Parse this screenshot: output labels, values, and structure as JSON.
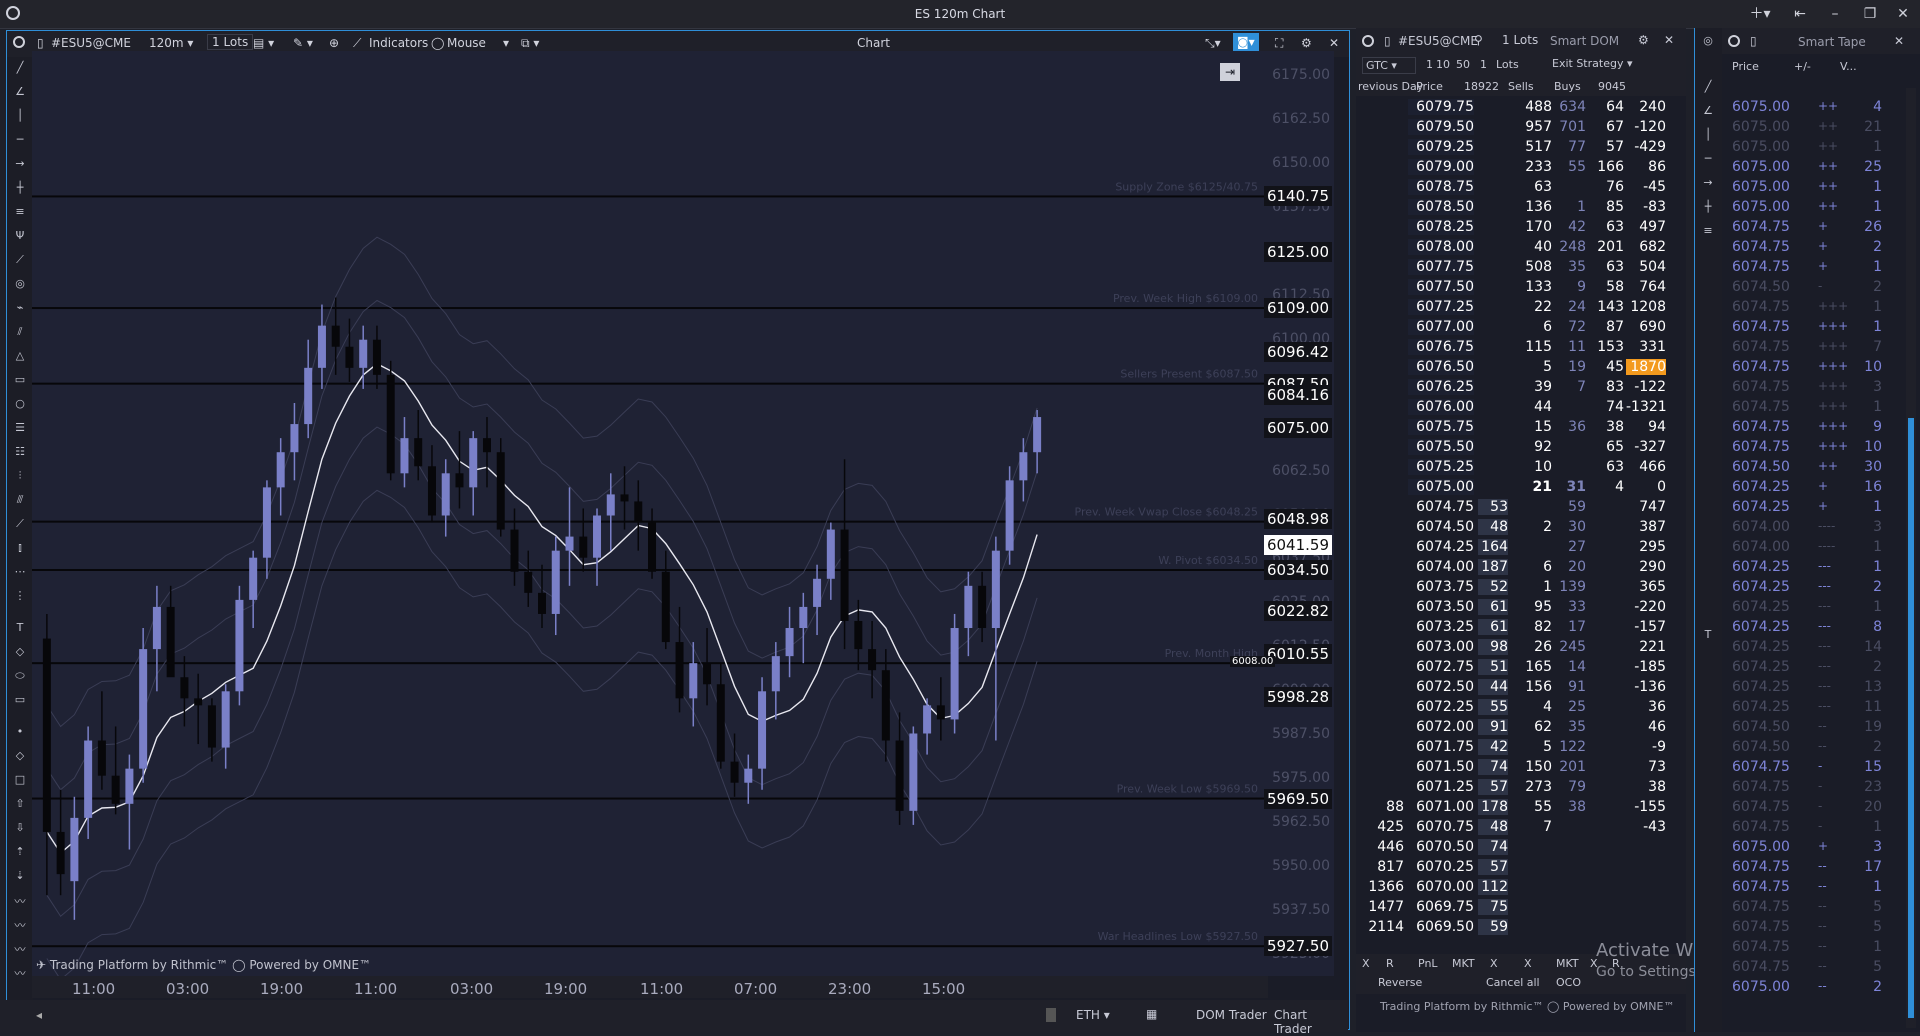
{
  "window": {
    "title": "ES 120m Chart"
  },
  "chart_panel": {
    "symbol": "#ESU5@CME",
    "timeframe": "120m",
    "lots": "1 Lots",
    "indicators_label": "Indicators",
    "mouse_label": "Mouse",
    "title": "Chart",
    "footer_left": "Trading Platform by Rithmic™",
    "footer_right": "Powered by OMNE™",
    "session": "ETH",
    "dom_trader_label": "DOM Trader",
    "chart_trader_label": "Chart Trader"
  },
  "chart_data": {
    "type": "candlestick",
    "y_ticks": [
      "6175.00",
      "6162.50",
      "6150.00",
      "6137.50",
      "6125.00",
      "6112.50",
      "6100.00",
      "6087.50",
      "6075.00",
      "6062.50",
      "6050.00",
      "6037.50",
      "6025.00",
      "6012.50",
      "6000.00",
      "5987.50",
      "5975.00",
      "5962.50",
      "5950.00",
      "5937.50",
      "5925.00"
    ],
    "x_ticks": [
      "11:00",
      "03:00",
      "19:00",
      "11:00",
      "03:00",
      "19:00",
      "11:00",
      "07:00",
      "23:00",
      "15:00"
    ],
    "price_labels": [
      {
        "text": "6140.75",
        "price": 6140.75,
        "highlight": false
      },
      {
        "text": "6125.00",
        "price": 6125.0,
        "highlight": false
      },
      {
        "text": "6109.00",
        "price": 6109.0,
        "highlight": false
      },
      {
        "text": "6096.42",
        "price": 6096.42,
        "highlight": false
      },
      {
        "text": "6087.50",
        "price": 6087.5,
        "highlight": false
      },
      {
        "text": "6084.16",
        "price": 6084.16,
        "highlight": false
      },
      {
        "text": "6075.00",
        "price": 6075.0,
        "highlight": false
      },
      {
        "text": "6048.98",
        "price": 6048.98,
        "highlight": false
      },
      {
        "text": "6041.59",
        "price": 6041.59,
        "highlight": true
      },
      {
        "text": "6034.50",
        "price": 6034.5,
        "highlight": false
      },
      {
        "text": "6022.82",
        "price": 6022.82,
        "highlight": false
      },
      {
        "text": "6010.55",
        "price": 6010.55,
        "highlight": false
      },
      {
        "text": "5998.28",
        "price": 5998.28,
        "highlight": false
      },
      {
        "text": "5969.50",
        "price": 5969.5,
        "highlight": false
      },
      {
        "text": "5927.50",
        "price": 5927.5,
        "highlight": false
      }
    ],
    "zones": [
      {
        "label": "Supply Zone $6125/40.75",
        "price": 6140.75
      },
      {
        "label": "Prev. Week High $6109.00",
        "price": 6109.0
      },
      {
        "label": "Sellers Present $6087.50",
        "price": 6087.5
      },
      {
        "label": "Prev. Week Vwap Close $6048.25",
        "price": 6048.25
      },
      {
        "label": "W. Pivot $6034.50",
        "price": 6034.5
      },
      {
        "label": "Prev. Month High",
        "price": 6008.0
      },
      {
        "label": "Prev. Week Low $5969.50",
        "price": 5969.5
      },
      {
        "label": "War Headlines Low $5927.50",
        "price": 5927.5
      }
    ],
    "flag_6008": "6008.00",
    "candles": [
      [
        6015,
        6022,
        5942,
        5960
      ],
      [
        5960,
        5972,
        5942,
        5948
      ],
      [
        5946,
        5970,
        5935,
        5964
      ],
      [
        5964,
        5990,
        5958,
        5986
      ],
      [
        5986,
        6000,
        5972,
        5976
      ],
      [
        5976,
        5990,
        5965,
        5968
      ],
      [
        5968,
        5982,
        5955,
        5978
      ],
      [
        5978,
        6018,
        5974,
        6012
      ],
      [
        6012,
        6030,
        6000,
        6024
      ],
      [
        6024,
        6030,
        6005,
        6004
      ],
      [
        6004,
        6010,
        5990,
        5998
      ],
      [
        5998,
        6005,
        5985,
        5996
      ],
      [
        5996,
        5998,
        5980,
        5984
      ],
      [
        5984,
        6002,
        5978,
        6000
      ],
      [
        6000,
        6030,
        5996,
        6026
      ],
      [
        6026,
        6040,
        6018,
        6038
      ],
      [
        6038,
        6060,
        6032,
        6058
      ],
      [
        6058,
        6072,
        6050,
        6068
      ],
      [
        6068,
        6082,
        6060,
        6076
      ],
      [
        6076,
        6100,
        6072,
        6092
      ],
      [
        6092,
        6110,
        6086,
        6104
      ],
      [
        6104,
        6112,
        6090,
        6098
      ],
      [
        6098,
        6106,
        6088,
        6092
      ],
      [
        6092,
        6104,
        6086,
        6100
      ],
      [
        6100,
        6104,
        6086,
        6090
      ],
      [
        6090,
        6094,
        6060,
        6062
      ],
      [
        6062,
        6078,
        6058,
        6072
      ],
      [
        6072,
        6080,
        6060,
        6064
      ],
      [
        6064,
        6070,
        6048,
        6050
      ],
      [
        6050,
        6066,
        6044,
        6062
      ],
      [
        6062,
        6074,
        6052,
        6058
      ],
      [
        6058,
        6074,
        6050,
        6072
      ],
      [
        6072,
        6078,
        6058,
        6068
      ],
      [
        6068,
        6072,
        6044,
        6046
      ],
      [
        6046,
        6052,
        6030,
        6034
      ],
      [
        6034,
        6040,
        6024,
        6028
      ],
      [
        6028,
        6036,
        6018,
        6022
      ],
      [
        6022,
        6044,
        6016,
        6040
      ],
      [
        6040,
        6058,
        6030,
        6044
      ],
      [
        6044,
        6052,
        6034,
        6038
      ],
      [
        6038,
        6052,
        6030,
        6050
      ],
      [
        6050,
        6062,
        6040,
        6056
      ],
      [
        6056,
        6064,
        6046,
        6054
      ],
      [
        6054,
        6060,
        6040,
        6048
      ],
      [
        6048,
        6052,
        6032,
        6034
      ],
      [
        6034,
        6040,
        6012,
        6014
      ],
      [
        6014,
        6024,
        5994,
        5998
      ],
      [
        5998,
        6014,
        5990,
        6008
      ],
      [
        6008,
        6018,
        5996,
        6002
      ],
      [
        6002,
        6008,
        5978,
        5980
      ],
      [
        5980,
        5988,
        5970,
        5974
      ],
      [
        5974,
        5982,
        5968,
        5978
      ],
      [
        5978,
        6004,
        5972,
        6000
      ],
      [
        6000,
        6014,
        5992,
        6010
      ],
      [
        6010,
        6024,
        6004,
        6018
      ],
      [
        6018,
        6028,
        6008,
        6024
      ],
      [
        6024,
        6036,
        6016,
        6032
      ],
      [
        6032,
        6048,
        6026,
        6046
      ],
      [
        6046,
        6066,
        6012,
        6020
      ],
      [
        6020,
        6026,
        6006,
        6012
      ],
      [
        6012,
        6020,
        5998,
        6006
      ],
      [
        6006,
        6012,
        5980,
        5986
      ],
      [
        5986,
        5994,
        5962,
        5966
      ],
      [
        5966,
        5990,
        5962,
        5988
      ],
      [
        5988,
        5998,
        5982,
        5996
      ],
      [
        5996,
        6004,
        5986,
        5992
      ],
      [
        5992,
        6022,
        5988,
        6018
      ],
      [
        6018,
        6034,
        6010,
        6030
      ],
      [
        6030,
        6034,
        6014,
        6018
      ],
      [
        6018,
        6044,
        5986,
        6040
      ],
      [
        6040,
        6064,
        6036,
        6060
      ],
      [
        6060,
        6072,
        6054,
        6068
      ],
      [
        6068,
        6080,
        6062,
        6078
      ]
    ]
  },
  "dom": {
    "symbol": "#ESU5@CME",
    "lots": "1 Lots",
    "title": "Smart DOM",
    "tif": "GTC",
    "qty_buttons": [
      "1",
      "10",
      "50",
      "1"
    ],
    "qty_lots": "Lots",
    "strategy": "Exit Strategy",
    "headers": [
      "revious Day",
      "Price",
      "18922",
      "Sells",
      "Buys",
      "9045"
    ],
    "rows": [
      [
        "",
        "6079.75",
        "",
        "488",
        "634",
        "64",
        "240"
      ],
      [
        "",
        "6079.50",
        "",
        "957",
        "701",
        "67",
        "-120"
      ],
      [
        "",
        "6079.25",
        "",
        "517",
        "77",
        "57",
        "-429"
      ],
      [
        "",
        "6079.00",
        "",
        "233",
        "55",
        "166",
        "86"
      ],
      [
        "",
        "6078.75",
        "",
        "63",
        "",
        "76",
        "-45"
      ],
      [
        "",
        "6078.50",
        "",
        "136",
        "1",
        "85",
        "-83"
      ],
      [
        "",
        "6078.25",
        "",
        "170",
        "42",
        "63",
        "497"
      ],
      [
        "",
        "6078.00",
        "",
        "40",
        "248",
        "201",
        "682"
      ],
      [
        "",
        "6077.75",
        "",
        "508",
        "35",
        "63",
        "504"
      ],
      [
        "",
        "6077.50",
        "",
        "133",
        "9",
        "58",
        "764"
      ],
      [
        "",
        "6077.25",
        "",
        "22",
        "24",
        "143",
        "1208"
      ],
      [
        "",
        "6077.00",
        "",
        "6",
        "72",
        "87",
        "690"
      ],
      [
        "",
        "6076.75",
        "",
        "115",
        "11",
        "153",
        "331"
      ],
      [
        "",
        "6076.50",
        "",
        "5",
        "19",
        "45",
        "1870"
      ],
      [
        "",
        "6076.25",
        "",
        "39",
        "7",
        "83",
        "-122"
      ],
      [
        "",
        "6076.00",
        "",
        "44",
        "",
        "74",
        "-1321"
      ],
      [
        "",
        "6075.75",
        "",
        "15",
        "36",
        "38",
        "94"
      ],
      [
        "",
        "6075.50",
        "",
        "92",
        "",
        "65",
        "-327"
      ],
      [
        "",
        "6075.25",
        "",
        "10",
        "",
        "63",
        "466"
      ],
      [
        "",
        "6075.00",
        "",
        "21",
        "31",
        "4",
        "0"
      ],
      [
        "",
        "6074.75",
        "53",
        "",
        "59",
        "",
        "747"
      ],
      [
        "",
        "6074.50",
        "48",
        "2",
        "30",
        "",
        "387"
      ],
      [
        "",
        "6074.25",
        "164",
        "",
        "27",
        "",
        "295"
      ],
      [
        "",
        "6074.00",
        "187",
        "6",
        "20",
        "",
        "290"
      ],
      [
        "",
        "6073.75",
        "52",
        "1",
        "139",
        "",
        "365"
      ],
      [
        "",
        "6073.50",
        "61",
        "95",
        "33",
        "",
        "-220"
      ],
      [
        "",
        "6073.25",
        "61",
        "82",
        "17",
        "",
        "-157"
      ],
      [
        "",
        "6073.00",
        "98",
        "26",
        "245",
        "",
        "221"
      ],
      [
        "",
        "6072.75",
        "51",
        "165",
        "14",
        "",
        "-185"
      ],
      [
        "",
        "6072.50",
        "44",
        "156",
        "91",
        "",
        "-136"
      ],
      [
        "",
        "6072.25",
        "55",
        "4",
        "25",
        "",
        "36"
      ],
      [
        "",
        "6072.00",
        "91",
        "62",
        "35",
        "",
        "46"
      ],
      [
        "",
        "6071.75",
        "42",
        "5",
        "122",
        "",
        "-9"
      ],
      [
        "",
        "6071.50",
        "74",
        "150",
        "201",
        "",
        "73"
      ],
      [
        "",
        "6071.25",
        "57",
        "273",
        "79",
        "",
        "38"
      ],
      [
        "88",
        "6071.00",
        "178",
        "55",
        "38",
        "",
        "-155"
      ],
      [
        "425",
        "6070.75",
        "48",
        "7",
        "",
        "",
        "-43"
      ],
      [
        "446",
        "6070.50",
        "74",
        "",
        "",
        "",
        ""
      ],
      [
        "817",
        "6070.25",
        "57",
        "",
        "",
        "",
        ""
      ],
      [
        "1366",
        "6070.00",
        "112",
        "",
        "",
        "",
        ""
      ],
      [
        "1477",
        "6069.75",
        "75",
        "",
        "",
        "",
        ""
      ],
      [
        "2114",
        "6069.50",
        "59",
        "",
        "",
        "",
        ""
      ]
    ],
    "footer_row1": [
      "X",
      "R",
      "PnL",
      "MKT",
      "X",
      "X",
      "MKT",
      "X",
      "R"
    ],
    "reverse": "Reverse",
    "cancel_all": "Cancel all",
    "oco": "OCO",
    "footer_left": "Trading Platform by Rithmic™",
    "footer_right": "Powered by OMNE™",
    "watermark1": "Activate Windows",
    "watermark2": "Go to Settings to activate Windows."
  },
  "tape": {
    "title": "Smart Tape",
    "headers": [
      "Price",
      "+/-",
      "V..."
    ],
    "rows": [
      [
        "6075.00",
        "++",
        "4",
        true
      ],
      [
        "6075.00",
        "++",
        "21",
        false
      ],
      [
        "6075.00",
        "++",
        "1",
        false
      ],
      [
        "6075.00",
        "++",
        "25",
        true
      ],
      [
        "6075.00",
        "++",
        "1",
        true
      ],
      [
        "6075.00",
        "++",
        "1",
        true
      ],
      [
        "6074.75",
        "+",
        "26",
        true
      ],
      [
        "6074.75",
        "+",
        "2",
        true
      ],
      [
        "6074.75",
        "+",
        "1",
        true
      ],
      [
        "6074.50",
        "-",
        "2",
        false
      ],
      [
        "6074.75",
        "+++",
        "1",
        false
      ],
      [
        "6074.75",
        "+++",
        "1",
        true
      ],
      [
        "6074.75",
        "+++",
        "7",
        false
      ],
      [
        "6074.75",
        "+++",
        "10",
        true
      ],
      [
        "6074.75",
        "+++",
        "3",
        false
      ],
      [
        "6074.75",
        "+++",
        "1",
        false
      ],
      [
        "6074.75",
        "+++",
        "9",
        true
      ],
      [
        "6074.75",
        "+++",
        "10",
        true
      ],
      [
        "6074.50",
        "++",
        "30",
        true
      ],
      [
        "6074.25",
        "+",
        "16",
        true
      ],
      [
        "6074.25",
        "+",
        "1",
        true
      ],
      [
        "6074.00",
        "----",
        "3",
        false
      ],
      [
        "6074.00",
        "----",
        "1",
        false
      ],
      [
        "6074.25",
        "---",
        "1",
        true
      ],
      [
        "6074.25",
        "---",
        "2",
        true
      ],
      [
        "6074.25",
        "---",
        "1",
        false
      ],
      [
        "6074.25",
        "---",
        "8",
        true
      ],
      [
        "6074.25",
        "---",
        "14",
        false
      ],
      [
        "6074.25",
        "---",
        "2",
        false
      ],
      [
        "6074.25",
        "---",
        "13",
        false
      ],
      [
        "6074.25",
        "---",
        "11",
        false
      ],
      [
        "6074.50",
        "--",
        "19",
        false
      ],
      [
        "6074.50",
        "--",
        "2",
        false
      ],
      [
        "6074.75",
        "-",
        "15",
        true
      ],
      [
        "6074.75",
        "-",
        "23",
        false
      ],
      [
        "6074.75",
        "-",
        "20",
        false
      ],
      [
        "6074.75",
        "-",
        "1",
        false
      ],
      [
        "6075.00",
        "+",
        "3",
        true
      ],
      [
        "6074.75",
        "--",
        "17",
        true
      ],
      [
        "6074.75",
        "--",
        "1",
        true
      ],
      [
        "6074.75",
        "--",
        "5",
        false
      ],
      [
        "6074.75",
        "--",
        "5",
        false
      ],
      [
        "6074.75",
        "--",
        "1",
        false
      ],
      [
        "6074.75",
        "--",
        "5",
        false
      ],
      [
        "6075.00",
        "--",
        "2",
        true
      ]
    ]
  }
}
